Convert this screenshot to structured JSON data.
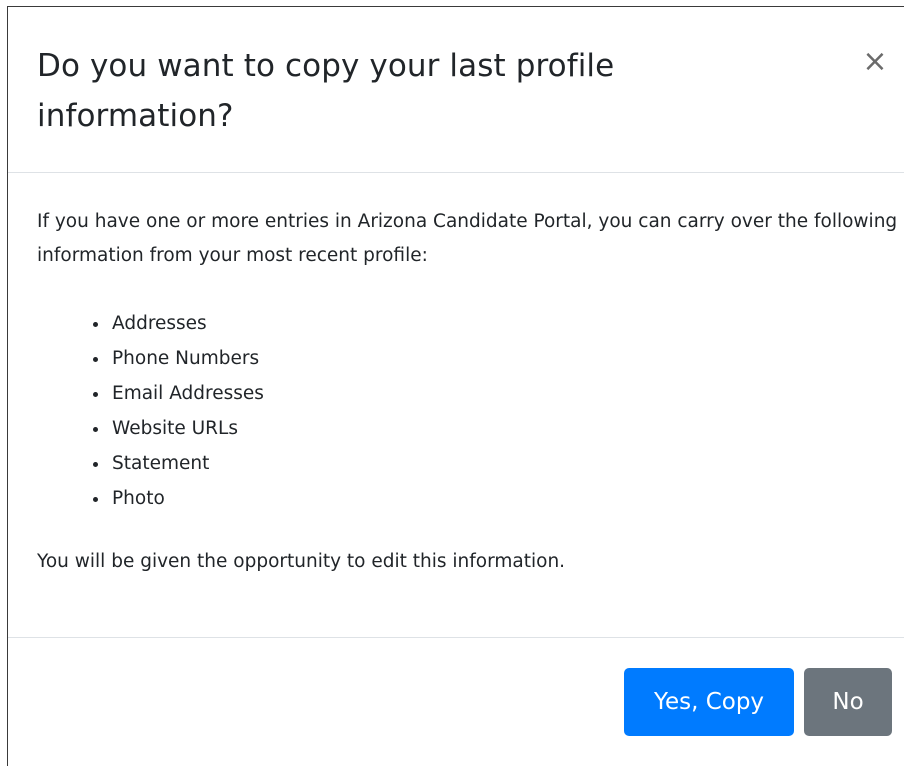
{
  "dialog": {
    "title": "Do you want to copy your last profile information?",
    "close_label": "×",
    "intro": "If you have one or more entries in Arizona Candidate Portal, you can carry over the following information from your most recent profile:",
    "items": [
      "Addresses",
      "Phone Numbers",
      "Email Addresses",
      "Website URLs",
      "Statement",
      "Photo"
    ],
    "note": "You will be given the opportunity to edit this information.",
    "yes_label": "Yes, Copy",
    "no_label": "No"
  },
  "colors": {
    "primary": "#007bff",
    "secondary": "#6c757d",
    "divider": "#dee2e6"
  }
}
